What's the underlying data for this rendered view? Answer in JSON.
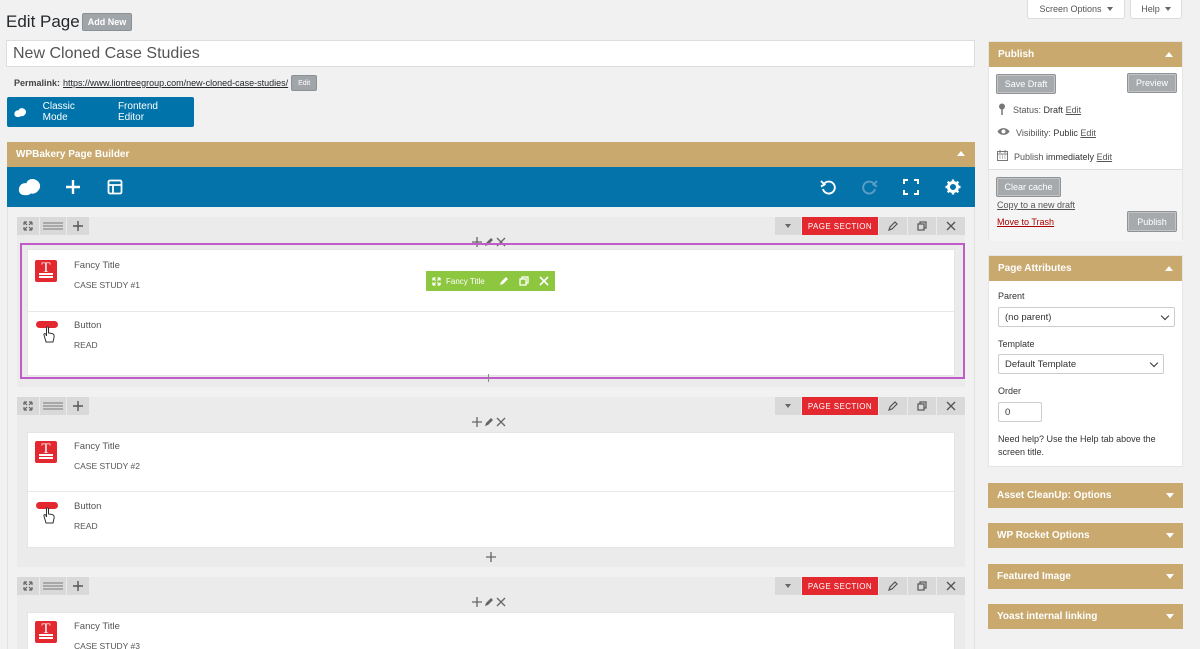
{
  "header": {
    "title": "Edit Page",
    "add_new": "Add New",
    "screen_options": "Screen Options",
    "help": "Help"
  },
  "post": {
    "title": "New Cloned Case Studies",
    "permalink_label": "Permalink:",
    "permalink_url": "https://www.liontreegroup.com/new-cloned-case-studies/",
    "permalink_edit": "Edit"
  },
  "mode_bar": {
    "classic": "Classic Mode",
    "frontend": "Frontend Editor"
  },
  "builder": {
    "title": "WPBakery Page Builder",
    "section_label": "PAGE SECTION",
    "sections": [
      {
        "title_name": "Fancy Title",
        "title_value": "CASE STUDY #1",
        "button_name": "Button",
        "button_value": "READ"
      },
      {
        "title_name": "Fancy Title",
        "title_value": "CASE STUDY #2",
        "button_name": "Button",
        "button_value": "READ"
      },
      {
        "title_name": "Fancy Title",
        "title_value": "CASE STUDY #3"
      }
    ],
    "hover_toolbar": "Fancy Title"
  },
  "colors": {
    "accent_gold": "#c9a96e",
    "builder_blue": "#0473aa",
    "section_red": "#e4282f",
    "hover_green": "#8dc63f",
    "highlight_purple": "#c05cc8"
  },
  "publish": {
    "title": "Publish",
    "save_draft": "Save Draft",
    "preview": "Preview",
    "status_label": "Status:",
    "status_value": "Draft",
    "visibility_label": "Visibility:",
    "visibility_value": "Public",
    "schedule_label": "Publish",
    "schedule_value": "immediately",
    "edit": "Edit",
    "clear_cache": "Clear cache",
    "copy_draft": "Copy to a new draft",
    "trash": "Move to Trash",
    "publish_btn": "Publish"
  },
  "attributes": {
    "title": "Page Attributes",
    "parent_label": "Parent",
    "parent_value": "(no parent)",
    "template_label": "Template",
    "template_value": "Default Template",
    "order_label": "Order",
    "order_value": "0",
    "help_text": "Need help? Use the Help tab above the screen title."
  },
  "collapsed_boxes": [
    "Asset CleanUp: Options",
    "WP Rocket Options",
    "Featured Image",
    "Yoast internal linking"
  ]
}
